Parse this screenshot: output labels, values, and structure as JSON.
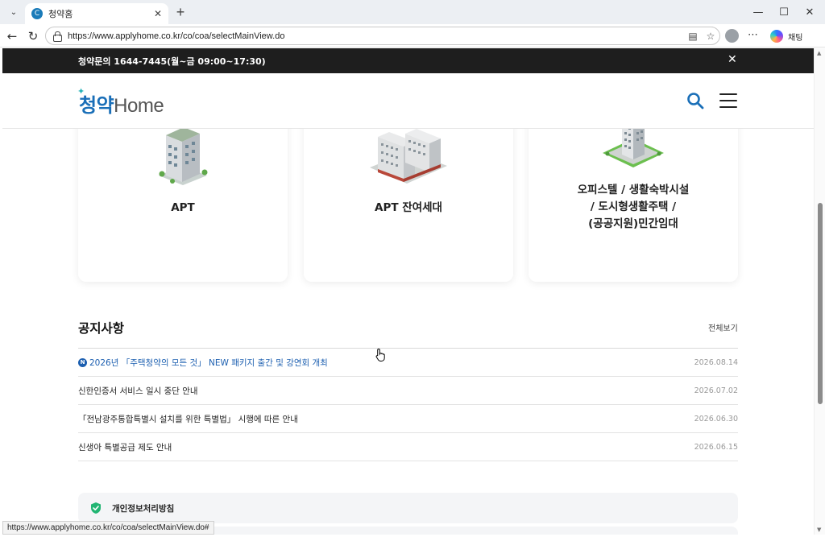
{
  "browser": {
    "tab_title": "청약홈",
    "tab_favicon": "C",
    "url": "https://www.applyhome.co.kr/co/coa/selectMainView.do",
    "chat_label": "채팅",
    "status_url": "https://www.applyhome.co.kr/co/coa/selectMainView.do#"
  },
  "site": {
    "top_notice": "청약문의 1644-7445(월~금 09:00~17:30)",
    "logo_kr": "청약",
    "logo_en": "Home"
  },
  "cards": [
    {
      "label": "APT",
      "icon": "apartment-building-icon"
    },
    {
      "label": "APT 잔여세대",
      "icon": "apartment-complex-icon"
    },
    {
      "label_lines": [
        "오피스텔 / 생활숙박시설",
        "/ 도시형생활주택 /",
        "(공공지원)민간임대"
      ],
      "icon": "officetel-tower-icon"
    }
  ],
  "notices": {
    "title": "공지사항",
    "view_all": "전체보기",
    "badge": "N",
    "items": [
      {
        "text": "2026년 「주택청약의 모든 것」 NEW 패키지 출간 및 강연회 개최",
        "date": "2026.08.14",
        "new": true
      },
      {
        "text": "신한인증서 서비스 일시 중단 안내",
        "date": "2026.07.02",
        "new": false
      },
      {
        "text": "「전남광주통합특별시 설치를 위한 특별법」 시행에 따른 안내",
        "date": "2026.06.30",
        "new": false
      },
      {
        "text": "신생아 특별공급 제도 안내",
        "date": "2026.06.15",
        "new": false
      }
    ]
  },
  "privacy": {
    "label": "개인정보처리방침"
  },
  "colors": {
    "brand_blue": "#1a6fb8",
    "brand_teal": "#27b3b8",
    "notice_highlight": "#1c5fb0",
    "shield_green": "#22b573"
  }
}
